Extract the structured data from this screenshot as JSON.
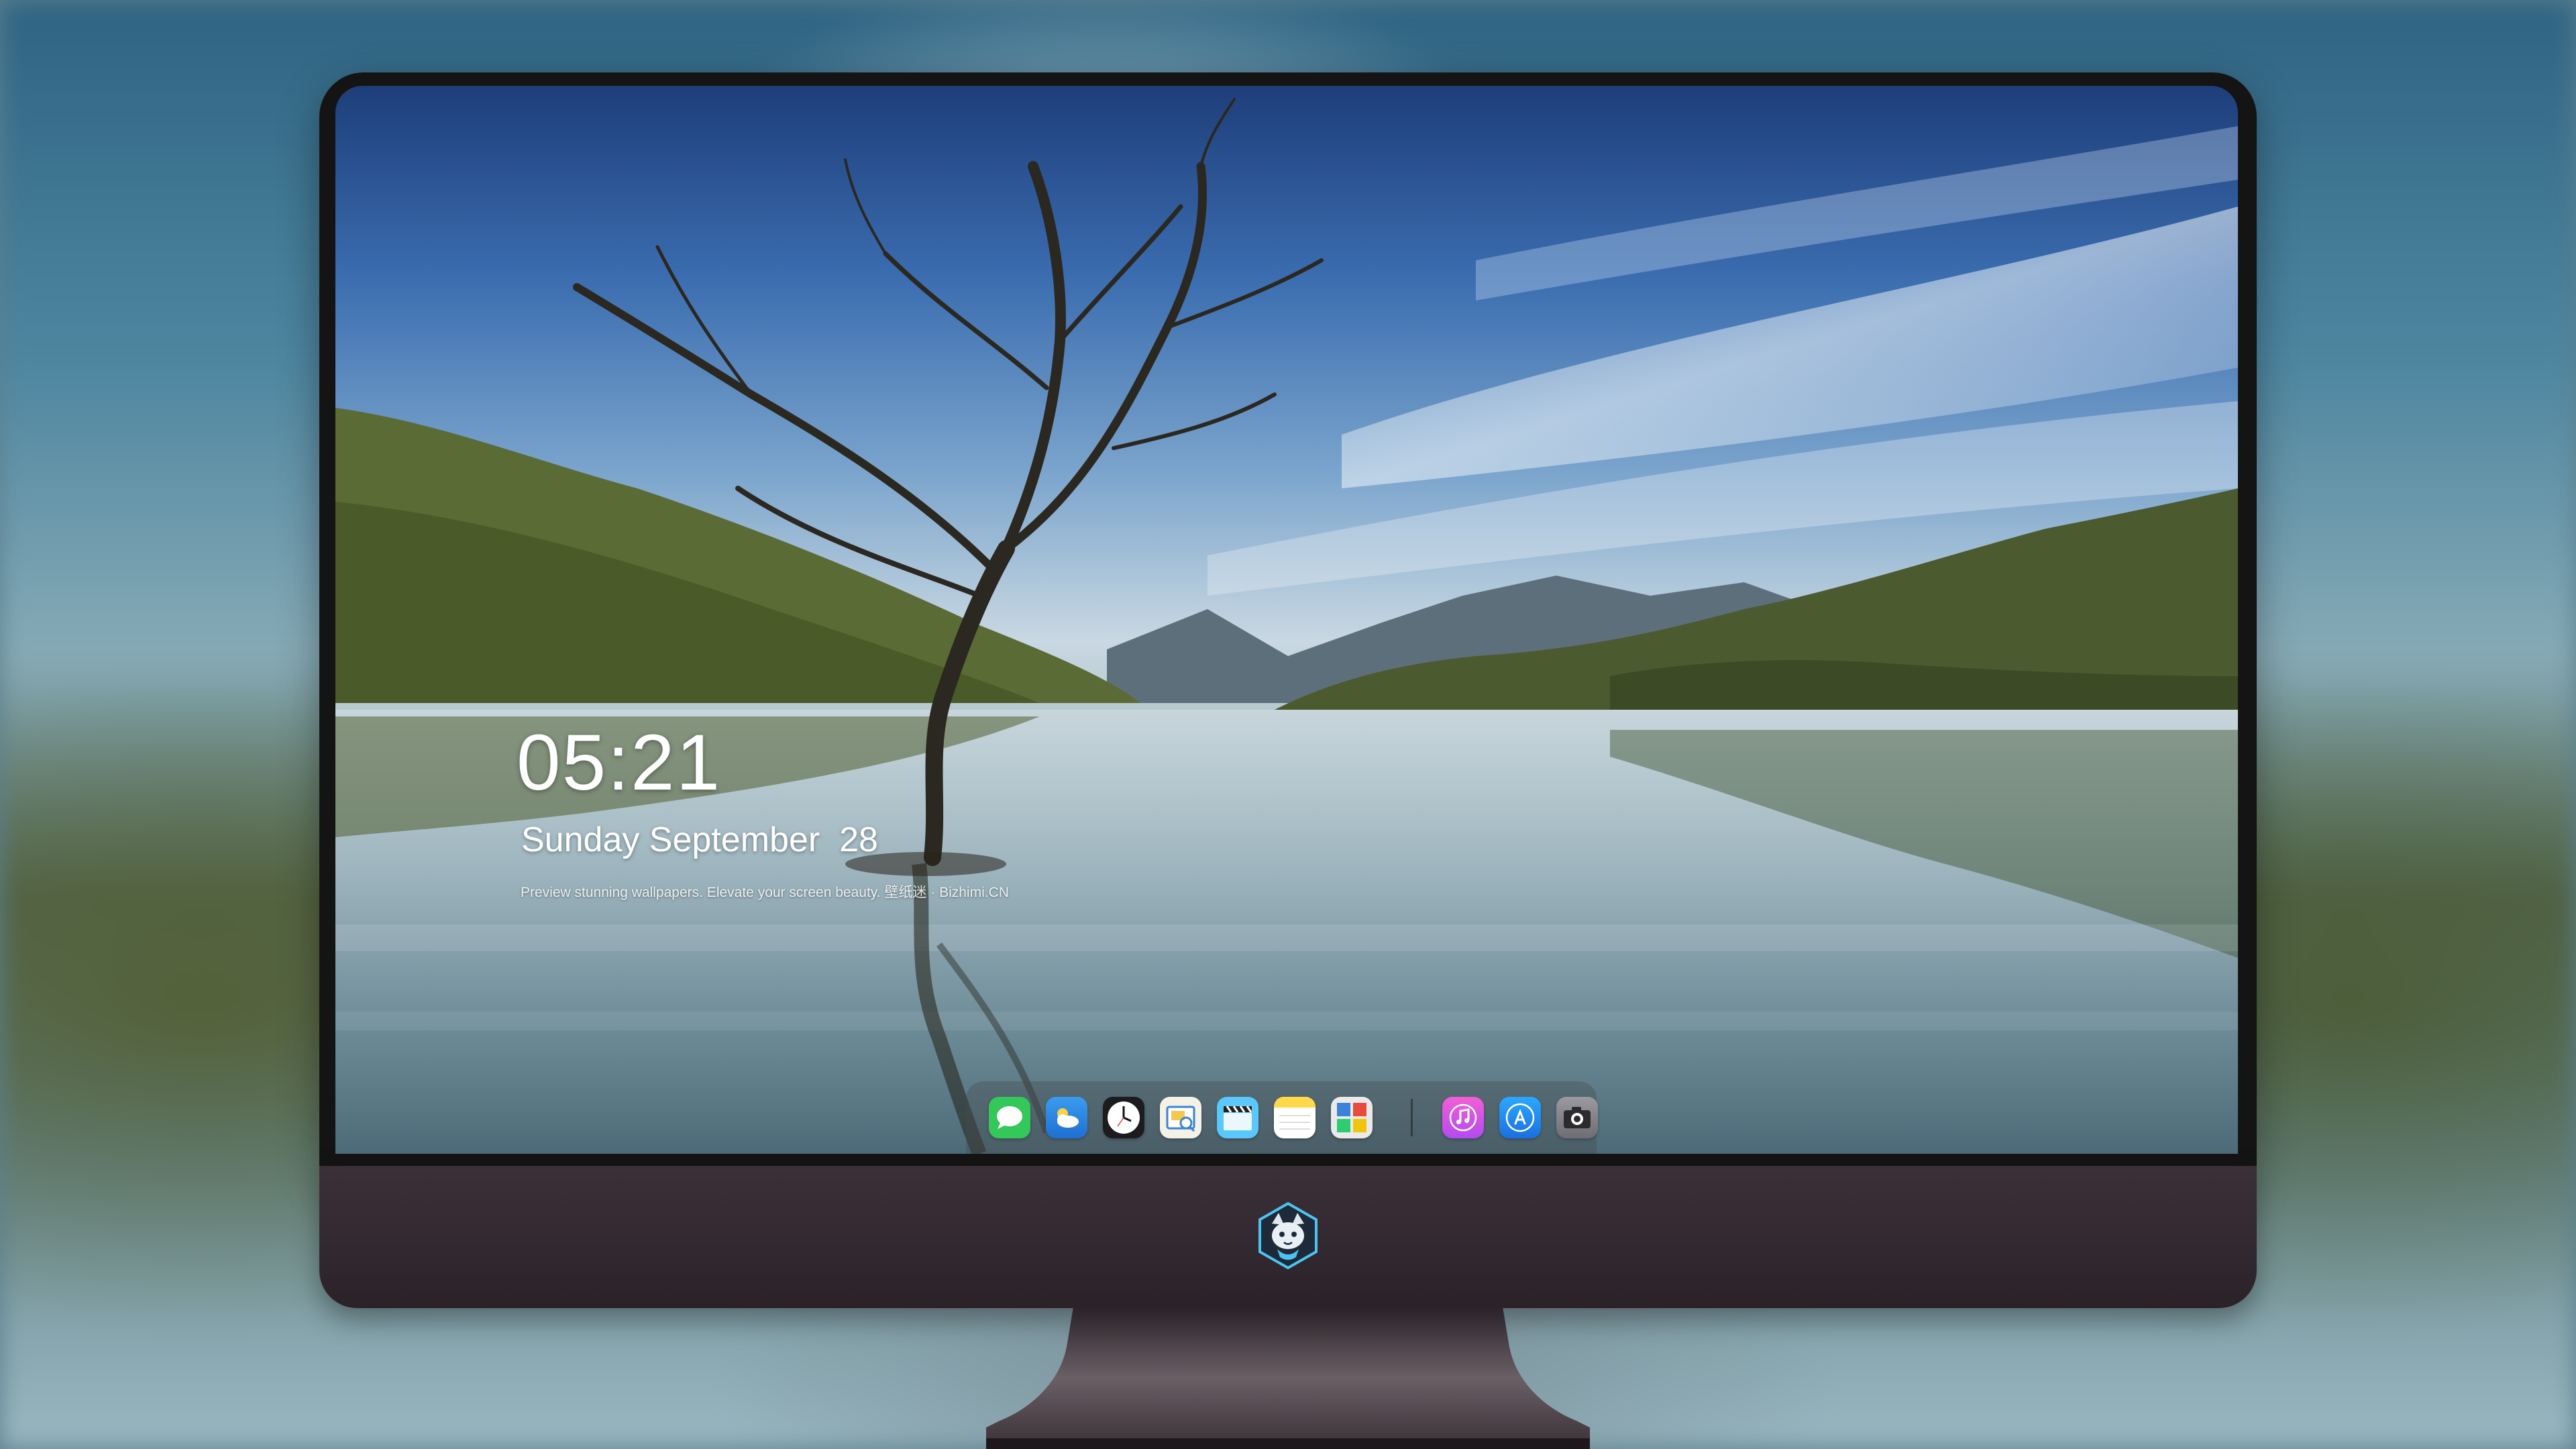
{
  "lock_screen": {
    "time": "05:21",
    "date": "Sunday September  28",
    "tagline": "Preview stunning wallpapers. Elevate your screen beauty. 壁纸迷 · Bizhimi.CN"
  },
  "dock": {
    "apps": [
      {
        "name": "Messages",
        "icon": "messages-icon",
        "color": "#34c759"
      },
      {
        "name": "Weather",
        "icon": "weather-icon",
        "color": "#2f8de4"
      },
      {
        "name": "Clock",
        "icon": "clock-icon",
        "color": "#1c1c1e"
      },
      {
        "name": "Preview",
        "icon": "preview-icon",
        "color": "#f2c94c"
      },
      {
        "name": "Video",
        "icon": "clapperboard-icon",
        "color": "#5ac8fa"
      },
      {
        "name": "Notes",
        "icon": "notes-icon",
        "color": "#ffd94a"
      },
      {
        "name": "Photo Collage",
        "icon": "collage-icon",
        "color": "#e9e9e9"
      },
      {
        "name": "Music",
        "icon": "music-icon",
        "color": "#e94bd1"
      },
      {
        "name": "App Store",
        "icon": "app-store-icon",
        "color": "#1a8cff"
      },
      {
        "name": "Camera",
        "icon": "camera-icon",
        "color": "#8e8e93"
      }
    ]
  },
  "device": {
    "chin_logo": "fox-mascot-logo"
  }
}
